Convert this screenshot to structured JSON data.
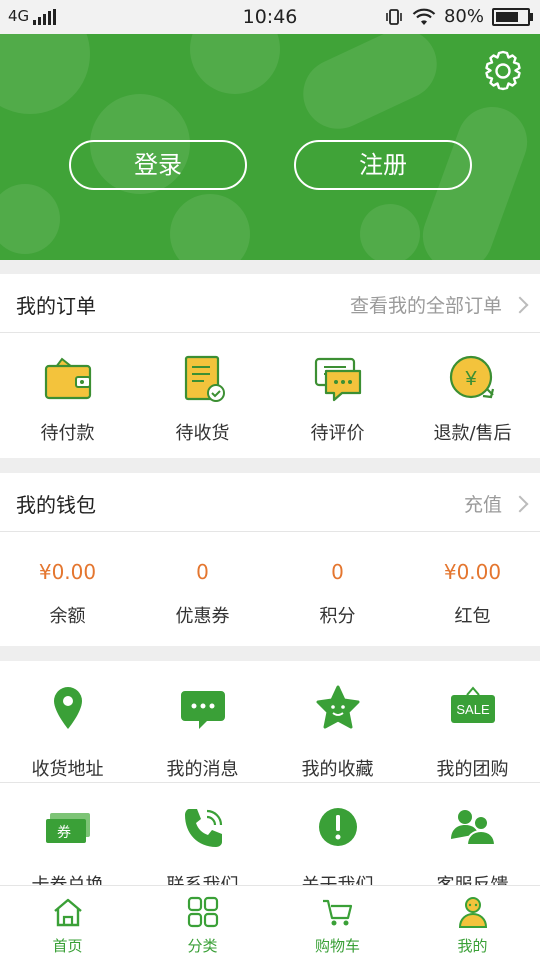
{
  "status_bar": {
    "network": "4G",
    "time": "10:46",
    "battery": "80%",
    "battery_level": 0.8
  },
  "header": {
    "login_label": "登录",
    "register_label": "注册",
    "settings_icon": "gear-icon"
  },
  "orders": {
    "title": "我的订单",
    "view_all": "查看我的全部订单",
    "items": [
      {
        "label": "待付款",
        "icon": "wallet-icon"
      },
      {
        "label": "待收货",
        "icon": "package-icon"
      },
      {
        "label": "待评价",
        "icon": "comment-icon"
      },
      {
        "label": "退款/售后",
        "icon": "refund-icon"
      }
    ]
  },
  "wallet": {
    "title": "我的钱包",
    "recharge": "充值",
    "items": [
      {
        "value": "¥0.00",
        "label": "余额"
      },
      {
        "value": "0",
        "label": "优惠券"
      },
      {
        "value": "0",
        "label": "积分"
      },
      {
        "value": "¥0.00",
        "label": "红包"
      }
    ]
  },
  "services": {
    "row1": [
      {
        "label": "收货地址",
        "icon": "location-icon"
      },
      {
        "label": "我的消息",
        "icon": "message-icon"
      },
      {
        "label": "我的收藏",
        "icon": "star-icon"
      },
      {
        "label": "我的团购",
        "icon": "sale-icon",
        "badge": "SALE"
      }
    ],
    "row2": [
      {
        "label": "卡券兑换",
        "icon": "coupon-icon",
        "badge": "券"
      },
      {
        "label": "联系我们",
        "icon": "phone-icon"
      },
      {
        "label": "关于我们",
        "icon": "info-icon"
      },
      {
        "label": "客服反馈",
        "icon": "users-icon"
      }
    ]
  },
  "tabbar": {
    "items": [
      {
        "label": "首页",
        "icon": "home-icon"
      },
      {
        "label": "分类",
        "icon": "category-icon"
      },
      {
        "label": "购物车",
        "icon": "cart-icon"
      },
      {
        "label": "我的",
        "icon": "profile-icon"
      }
    ]
  },
  "colors": {
    "brand_green": "#40a338",
    "icon_yellow": "#f3c33c",
    "value_orange": "#e4762f"
  }
}
